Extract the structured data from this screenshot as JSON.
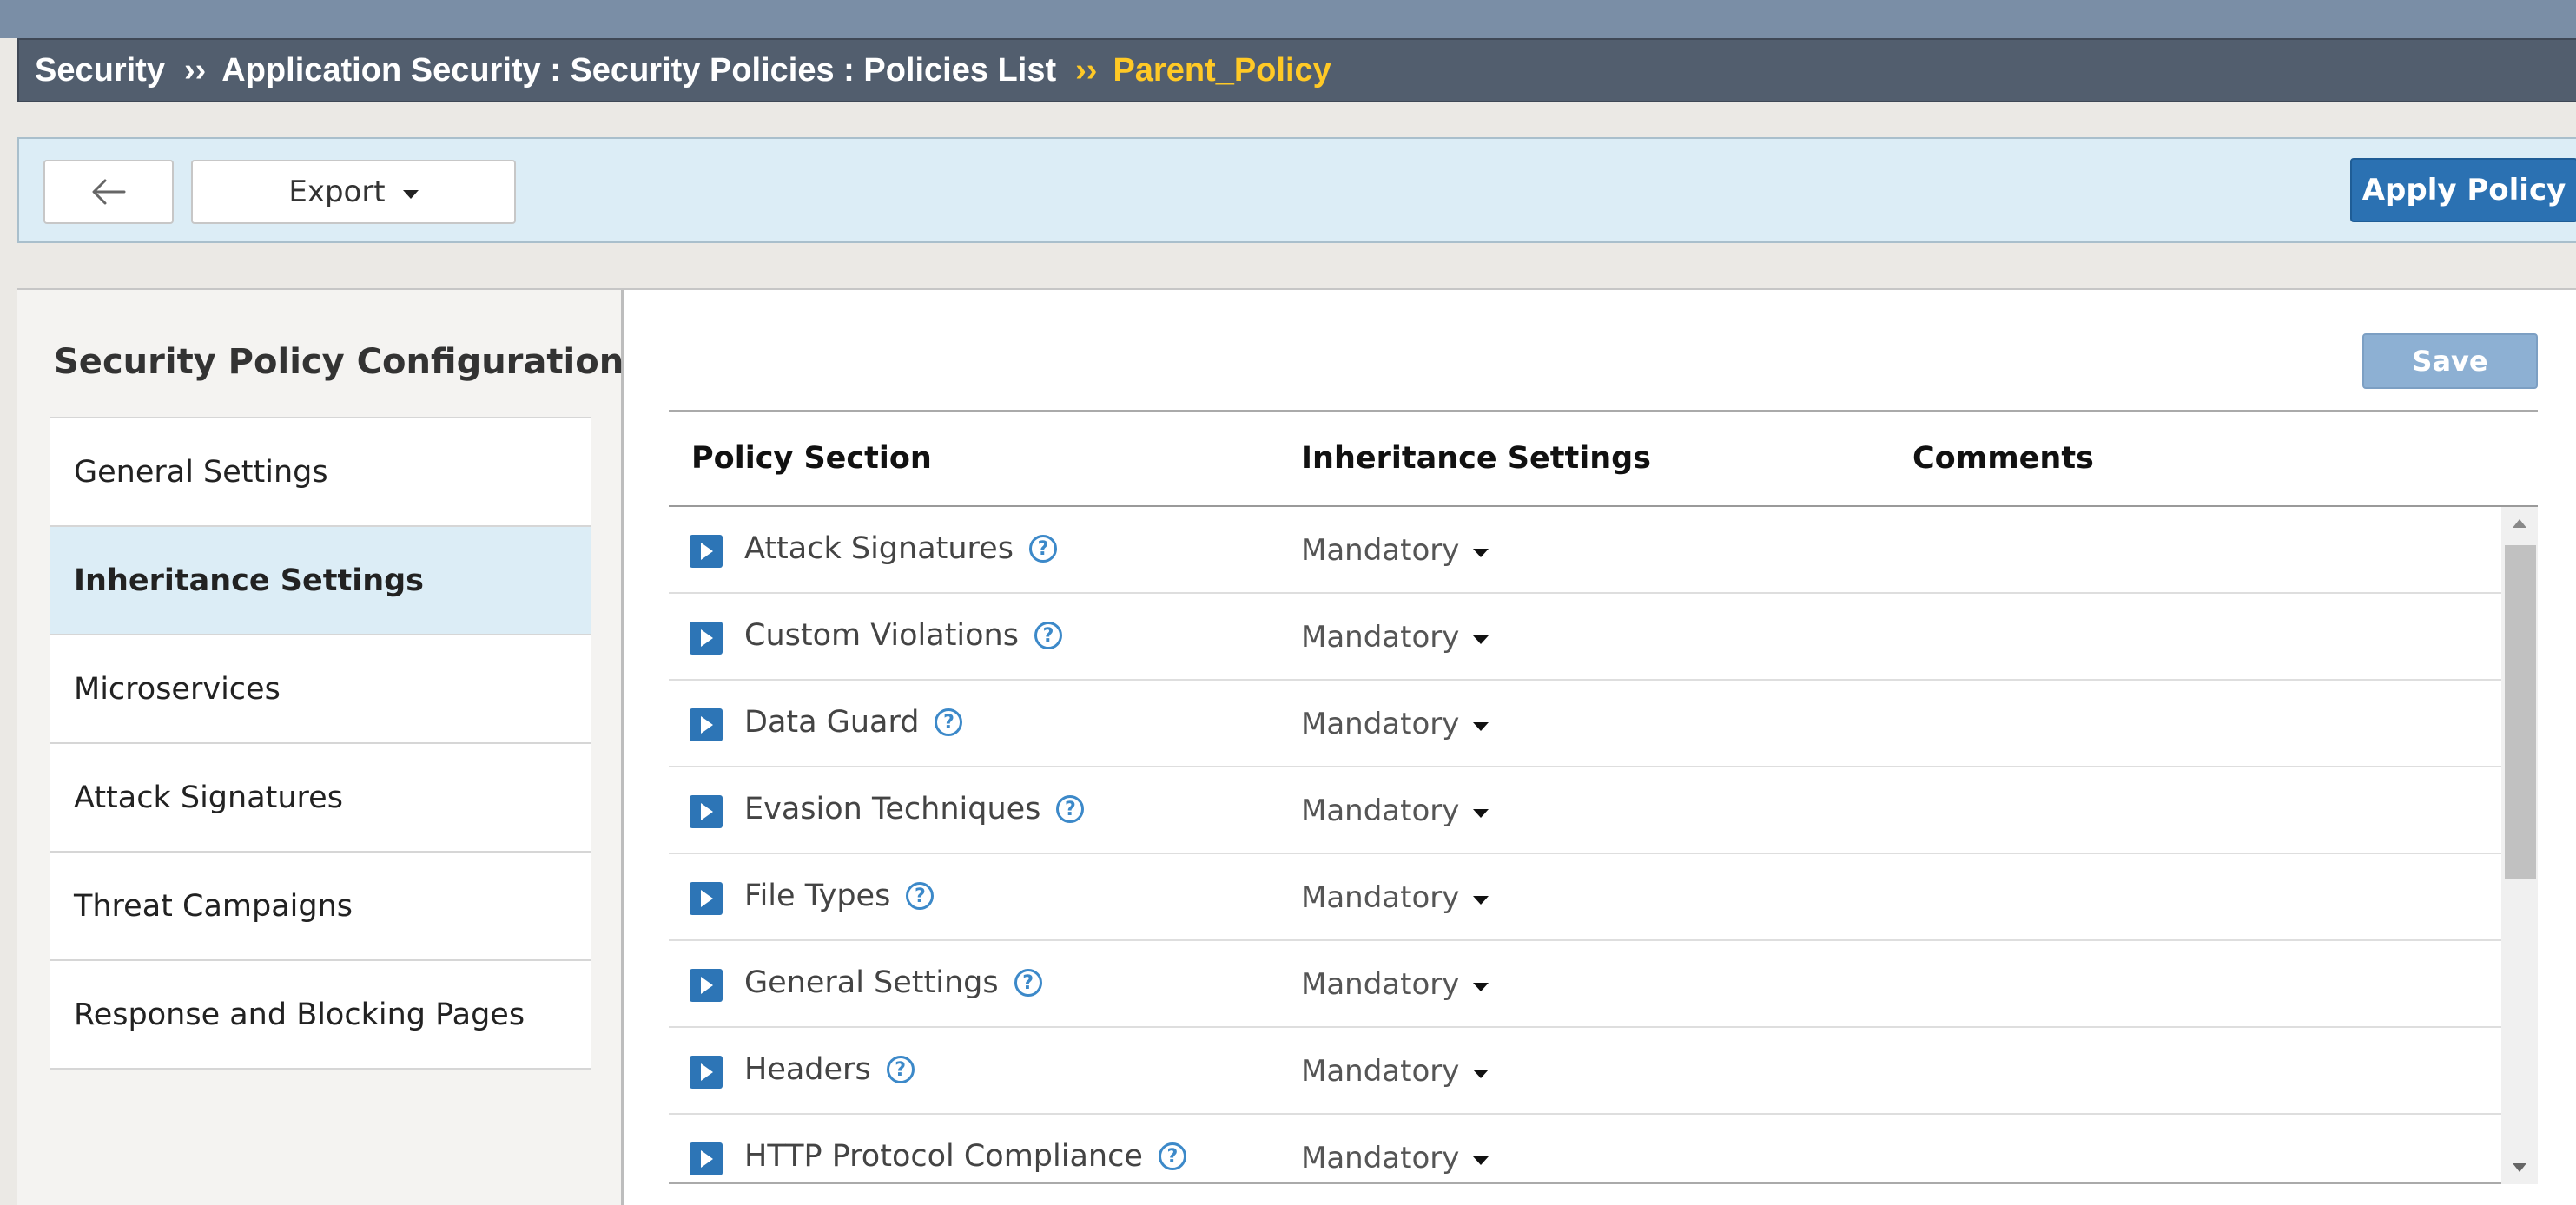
{
  "breadcrumb": {
    "items": [
      "Security",
      "Application Security : Security Policies : Policies List"
    ],
    "separator": "››",
    "current": "Parent_Policy"
  },
  "toolbar": {
    "back_icon": "arrow-left-icon",
    "export_label": "Export",
    "apply_label": "Apply Policy"
  },
  "sidebar": {
    "title": "Security Policy Configuration",
    "items": [
      {
        "label": "General Settings",
        "active": false
      },
      {
        "label": "Inheritance Settings",
        "active": true
      },
      {
        "label": "Microservices",
        "active": false
      },
      {
        "label": "Attack Signatures",
        "active": false
      },
      {
        "label": "Threat Campaigns",
        "active": false
      },
      {
        "label": "Response and Blocking Pages",
        "active": false
      }
    ]
  },
  "main": {
    "save_label": "Save",
    "table": {
      "columns": [
        "Policy Section",
        "Inheritance Settings",
        "Comments"
      ],
      "rows": [
        {
          "section": "Attack Signatures",
          "inheritance": "Mandatory",
          "comments": ""
        },
        {
          "section": "Custom Violations",
          "inheritance": "Mandatory",
          "comments": ""
        },
        {
          "section": "Data Guard",
          "inheritance": "Mandatory",
          "comments": ""
        },
        {
          "section": "Evasion Techniques",
          "inheritance": "Mandatory",
          "comments": ""
        },
        {
          "section": "File Types",
          "inheritance": "Mandatory",
          "comments": ""
        },
        {
          "section": "General Settings",
          "inheritance": "Mandatory",
          "comments": ""
        },
        {
          "section": "Headers",
          "inheritance": "Mandatory",
          "comments": ""
        },
        {
          "section": "HTTP Protocol Compliance",
          "inheritance": "Mandatory",
          "comments": ""
        }
      ]
    }
  },
  "colors": {
    "breadcrumb_bg": "#525e6e",
    "breadcrumb_current": "#ffc926",
    "toolbar_bg": "#dcedf6",
    "primary_button": "#2b71b2",
    "save_button": "#8db0d3",
    "expand_icon": "#2d75b6",
    "help_icon": "#3c89c9"
  }
}
